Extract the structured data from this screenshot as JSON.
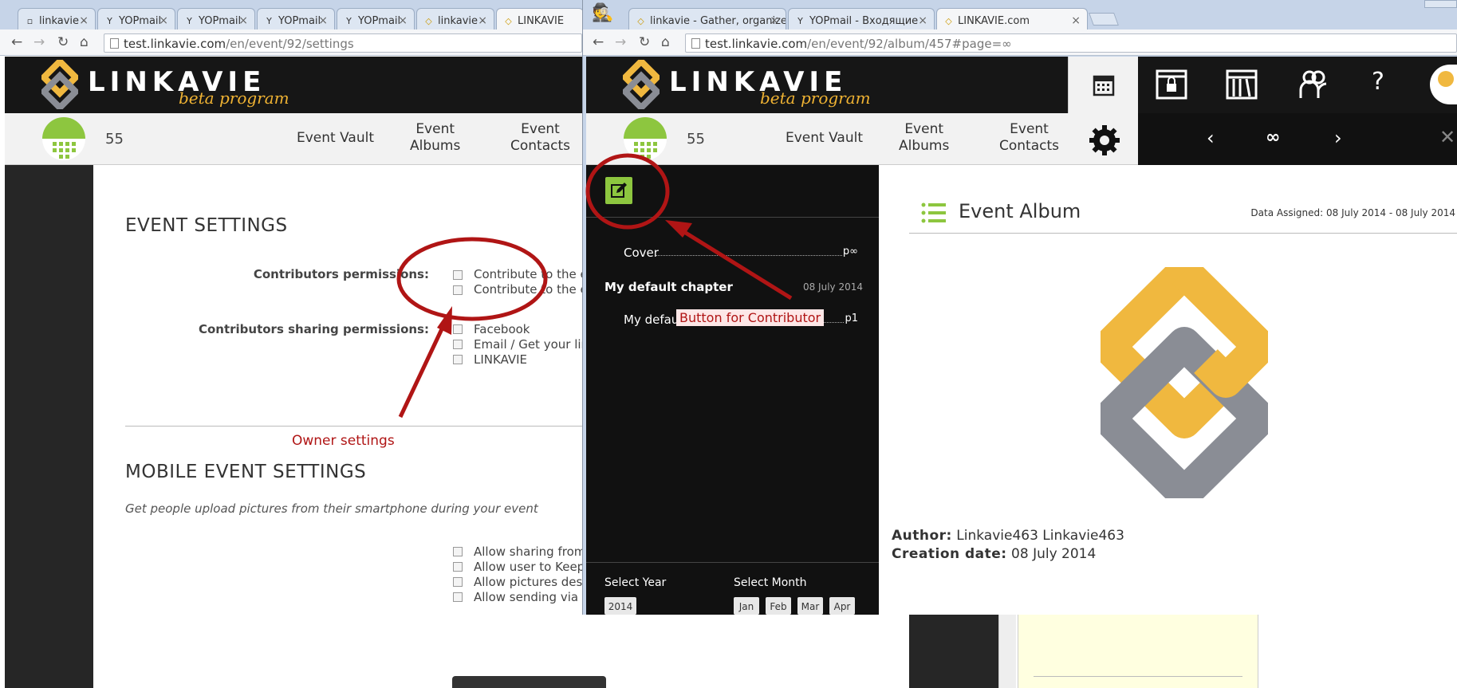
{
  "left_browser": {
    "tabs": [
      {
        "label": "linkavie -"
      },
      {
        "label": "YOPmail"
      },
      {
        "label": "YOPmail"
      },
      {
        "label": "YOPmail"
      },
      {
        "label": "YOPmail"
      },
      {
        "label": "linkavie -"
      },
      {
        "label": "LINKAVIE"
      }
    ],
    "url_domain": "test.linkavie.com",
    "url_path": "/en/event/92/settings"
  },
  "right_browser": {
    "tabs": [
      {
        "label": "linkavie - Gather, organize"
      },
      {
        "label": "YOPmail - Входящие"
      },
      {
        "label": "LINKAVIE.com"
      }
    ],
    "url_domain": "test.linkavie.com",
    "url_path": "/en/event/92/album/457#page=∞"
  },
  "site": {
    "logo": "LINKAVIE",
    "beta": "beta program",
    "count": "55",
    "nav": {
      "vault": "Event Vault",
      "albums_1": "Event",
      "albums_2": "Albums",
      "contacts_1": "Event",
      "contacts_2": "Contacts"
    }
  },
  "settings": {
    "title": "EVENT SETTINGS",
    "contributors_permissions_label": "Contributors permissions:",
    "perm_options": [
      "Contribute to the ev",
      "Contribute to the ev"
    ],
    "sharing_label": "Contributors sharing permissions:",
    "sharing_options": [
      "Facebook",
      "Email / Get your link",
      "LINKAVIE"
    ],
    "mobile_title": "MOBILE EVENT SETTINGS",
    "mobile_desc": "Get people upload pictures from their smartphone during your event",
    "mobile_options": [
      "Allow sharing from",
      "Allow user to Keep o",
      "Allow pictures descr",
      "Allow sending via all"
    ]
  },
  "annotations": {
    "owner_settings": "Owner settings",
    "button_contributor": "Button for Contributor"
  },
  "album": {
    "toc_cover": "Cover",
    "toc_cover_page": "p∞",
    "chapter": "My default chapter",
    "chapter_date": "08 July 2014",
    "toc_item": "My defau",
    "toc_item_page": "p1",
    "select_year": "Select Year",
    "select_month": "Select Month",
    "year": "2014",
    "months": [
      "Jan",
      "Feb",
      "Mar",
      "Apr"
    ],
    "title": "Event Album",
    "date_assigned": "Data Assigned: 08 July 2014 - 08 July 2014",
    "author_label": "Author:",
    "author_value": "Linkavie463 Linkavie463",
    "creation_label": "Creation date:",
    "creation_value": "08 July 2014",
    "pager": "∞",
    "help": "?"
  },
  "colors": {
    "accent_green": "#8dc63f",
    "logo_gold": "#f0b83f",
    "logo_gray": "#8a8d95",
    "annotation_red": "#b01515"
  }
}
